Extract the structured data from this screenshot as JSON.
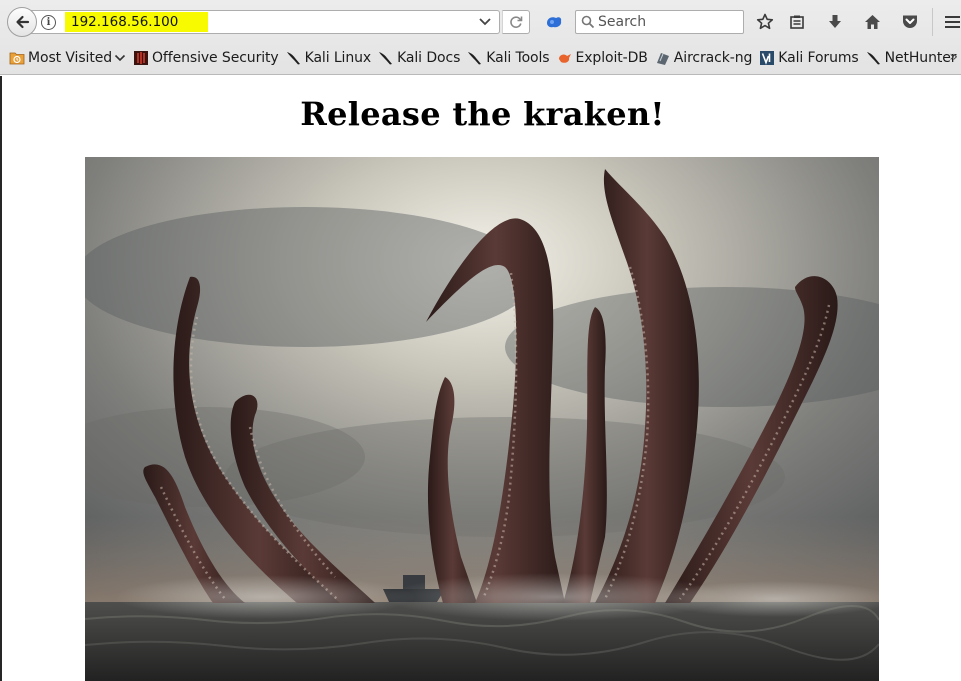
{
  "browser": {
    "url": "192.168.56.100",
    "search_placeholder": "Search",
    "url_highlight_color": "#f8fb00",
    "icons": {
      "back": "back-arrow-icon",
      "info": "info-icon",
      "url_dropdown": "chevron-down-icon",
      "reload": "reload-icon",
      "search_engine": "search-engine-icon",
      "search": "magnifier-icon",
      "bookmark": "star-icon",
      "reading_list": "clipboard-icon",
      "downloads": "download-arrow-icon",
      "home": "home-icon",
      "pocket": "pocket-icon",
      "menu": "hamburger-menu-icon"
    }
  },
  "bookmarks": {
    "items": [
      {
        "label": "Most Visited",
        "icon": "folder-icon"
      },
      {
        "label": "Offensive Security",
        "icon": "offsec-icon"
      },
      {
        "label": "Kali Linux",
        "icon": "kali-dragon-icon"
      },
      {
        "label": "Kali Docs",
        "icon": "kali-dragon-icon"
      },
      {
        "label": "Kali Tools",
        "icon": "kali-dragon-icon"
      },
      {
        "label": "Exploit-DB",
        "icon": "exploit-db-icon"
      },
      {
        "label": "Aircrack-ng",
        "icon": "aircrack-icon"
      },
      {
        "label": "Kali Forums",
        "icon": "kali-forums-icon"
      },
      {
        "label": "NetHunter",
        "icon": "kali-dragon-icon"
      }
    ],
    "overflow": "»"
  },
  "page": {
    "title": "Release the kraken!",
    "image_subject": "kraken-image"
  }
}
